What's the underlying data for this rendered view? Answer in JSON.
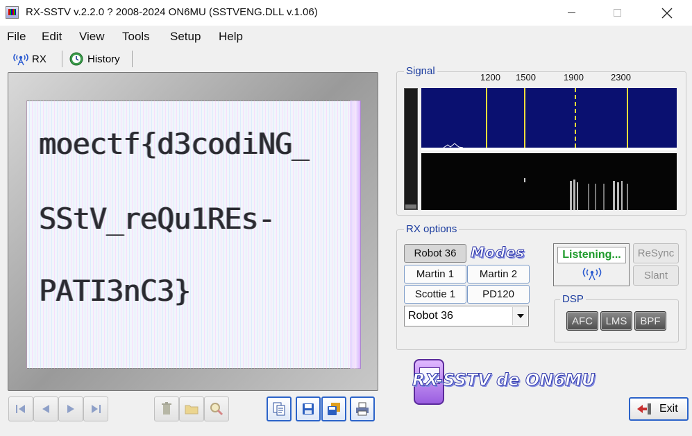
{
  "window": {
    "title": "RX-SSTV v.2.2.0 ? 2008-2024 ON6MU (SSTVENG.DLL v.1.06)"
  },
  "menu": [
    "File",
    "Edit",
    "View",
    "Tools",
    "Setup",
    "Help"
  ],
  "tabs": [
    {
      "label": "RX",
      "icon": "antenna-icon",
      "active": true
    },
    {
      "label": "History",
      "icon": "history-icon",
      "active": false
    }
  ],
  "decoded_image": {
    "lines": [
      "moectf{d3codiNG_",
      "SStV_reQu1REs-",
      "PATI3nC3}"
    ]
  },
  "nav_buttons": [
    "first-icon",
    "prev-icon",
    "next-icon",
    "last-icon"
  ],
  "tool_buttons": [
    "trash-icon",
    "folder-icon",
    "zoom-icon",
    "copy-icon",
    "save-icon",
    "save-as-icon",
    "print-icon"
  ],
  "signal": {
    "label": "Signal",
    "freq_labels": [
      "1200",
      "1500",
      "1900",
      "2300"
    ],
    "colors": {
      "spectrum_bg": "#0a1070",
      "marker": "#f2de3a",
      "waterfall_bg": "#050505"
    }
  },
  "rx_options": {
    "label": "RX options",
    "modes_logo": "Modes",
    "mode_buttons": [
      "Robot 36",
      "Martin 1",
      "Martin 2",
      "Scottie 1",
      "PD120"
    ],
    "active_mode": "Robot 36",
    "selected_mode": "Robot 36",
    "status": "Listening...",
    "status_color": "#1d9a2a",
    "resync_label": "ReSync",
    "slant_label": "Slant",
    "dsp": {
      "label": "DSP",
      "buttons": [
        "AFC",
        "LMS",
        "BPF"
      ]
    }
  },
  "brand": {
    "logo_text": "RX-SSTV de ON6MU"
  },
  "exit_label": "Exit"
}
